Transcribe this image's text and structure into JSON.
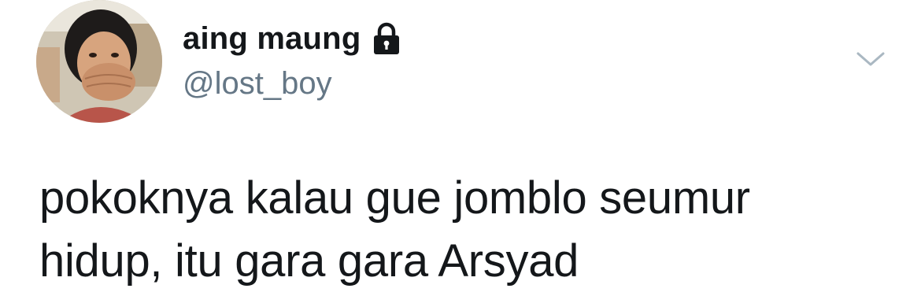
{
  "tweet": {
    "author": {
      "display_name": "aing maung",
      "handle": "@lost_boy",
      "protected_icon": "lock-icon",
      "avatar": "avatar"
    },
    "menu_icon": "chevron-down-icon",
    "text_lines": [
      "pokoknya kalau gue jomblo seumur",
      "hidup, itu gara gara Arsyad"
    ]
  },
  "colors": {
    "text_primary": "#14171a",
    "text_secondary": "#657786",
    "caret": "#aab8c2"
  }
}
